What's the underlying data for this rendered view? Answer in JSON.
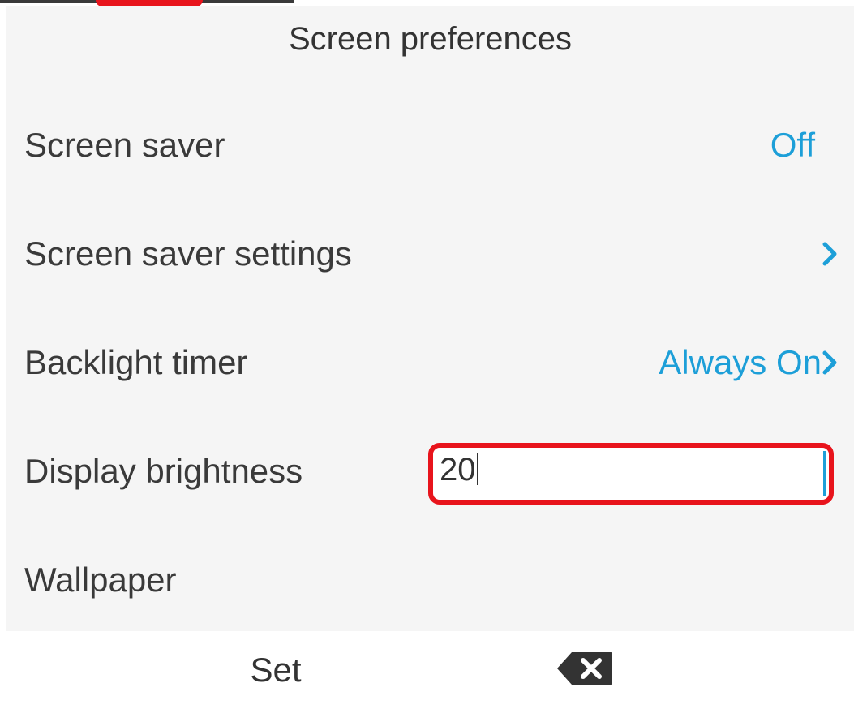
{
  "header": {
    "title": "Screen preferences"
  },
  "settings": {
    "screen_saver": {
      "label": "Screen saver",
      "value": "Off"
    },
    "screen_saver_settings": {
      "label": "Screen saver settings",
      "icon": "chevron-right-icon"
    },
    "backlight_timer": {
      "label": "Backlight timer",
      "value": "Always On",
      "icon": "chevron-right-icon"
    },
    "display_brightness": {
      "label": "Display brightness",
      "value": "20"
    },
    "wallpaper": {
      "label": "Wallpaper"
    }
  },
  "softkeys": {
    "set_label": "Set",
    "backspace_icon": "backspace-icon"
  },
  "colors": {
    "accent": "#1d9fd8",
    "highlight": "#e8141c",
    "background": "#f5f5f5",
    "text": "#3a3a3a"
  }
}
